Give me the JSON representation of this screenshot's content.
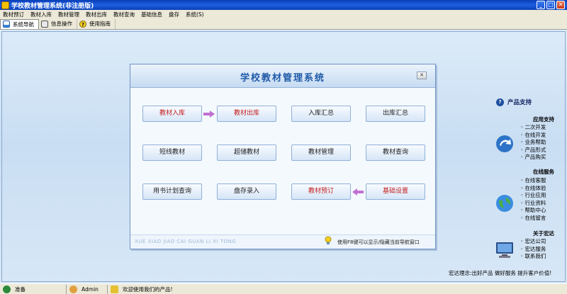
{
  "window": {
    "title": "学校教材管理系统(非注册版)",
    "controls": {
      "minimize": "_",
      "maximize": "□",
      "close": "✕"
    }
  },
  "menu": [
    "教材预订",
    "教材入库",
    "教材管理",
    "教材出库",
    "教材查询",
    "基础信息",
    "盘存",
    "系统(S)"
  ],
  "toolbar": {
    "nav": "系统导航",
    "info": "信息操作",
    "help": "使用指南"
  },
  "dialog": {
    "title": "学校教材管理系统",
    "close": "✕",
    "buttons": {
      "r1": [
        "教材入库",
        "教材出库",
        "入库汇总",
        "出库汇总"
      ],
      "r2": [
        "短线教材",
        "超储教材",
        "教材管理",
        "教材查询"
      ],
      "r3": [
        "用书计划查询",
        "盘存录入",
        "教材预订",
        "基础设置"
      ]
    },
    "footer_pinyin": "XUE XIAO JIAO CAI GUAN LI XI TONG",
    "footer_hint": "使用F8键可以显示/隐藏当前导航窗口"
  },
  "support": {
    "title": "产品支持",
    "app_support": {
      "title": "应用支持",
      "items": [
        "二次开发",
        "在线开发",
        "业务帮助",
        "产品形式",
        "产品购买"
      ]
    },
    "online_service": {
      "title": "在线服务",
      "items": [
        "在线客服",
        "在线体验",
        "行业应用",
        "行业资料",
        "帮助中心",
        "在线留言"
      ]
    },
    "about": {
      "title": "关于宏达",
      "items": [
        "宏达公司",
        "宏达服务",
        "联系我们"
      ]
    },
    "slogan": "宏达理念:出好产品  做好服务  提升客户价值!"
  },
  "status": {
    "ready": "准备",
    "user": "Admin",
    "welcome": "欢迎使用我们的产品!"
  },
  "colors": {
    "titlebar": "#0a3fb8",
    "dialog_title": "#1f5aa8",
    "red_label": "#c42020",
    "arrow": "#c070d0"
  }
}
